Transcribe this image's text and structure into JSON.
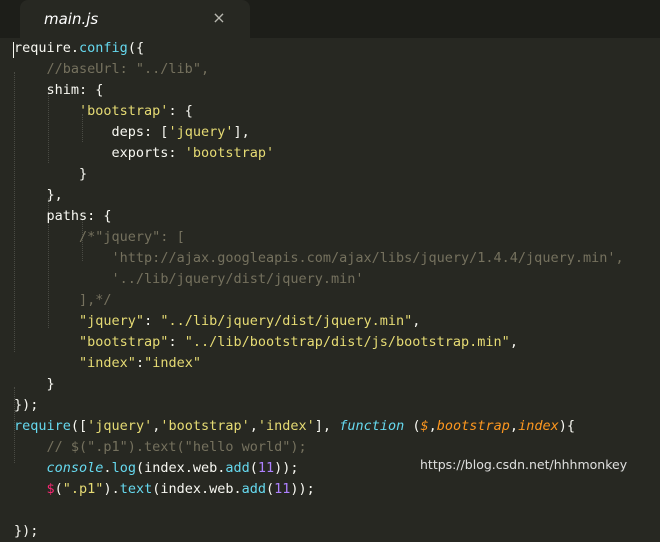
{
  "tab": {
    "title": "main.js",
    "close_glyph": "×"
  },
  "watermark": "https://blog.csdn.net/hhhmonkey",
  "colors": {
    "background": "#272822",
    "text": "#f8f8f2",
    "comment": "#75715e",
    "string": "#e6db74",
    "function": "#66d9ef",
    "number": "#ae81ff",
    "parameter": "#fd971f",
    "dollar": "#f92672"
  },
  "code_lines": [
    [
      [
        "plain",
        "require"
      ],
      [
        "plain",
        "."
      ],
      [
        "func",
        "config"
      ],
      [
        "plain",
        "({"
      ]
    ],
    [
      [
        "plain",
        "    "
      ],
      [
        "comment",
        "//baseUrl: \"../lib\","
      ]
    ],
    [
      [
        "plain",
        "    shim: {"
      ]
    ],
    [
      [
        "plain",
        "        "
      ],
      [
        "string",
        "'bootstrap'"
      ],
      [
        "plain",
        ": {"
      ]
    ],
    [
      [
        "plain",
        "            deps: ["
      ],
      [
        "string",
        "'jquery'"
      ],
      [
        "plain",
        "],"
      ]
    ],
    [
      [
        "plain",
        "            exports: "
      ],
      [
        "string",
        "'bootstrap'"
      ]
    ],
    [
      [
        "plain",
        "        }"
      ]
    ],
    [
      [
        "plain",
        "    },"
      ]
    ],
    [
      [
        "plain",
        "    paths: {"
      ]
    ],
    [
      [
        "plain",
        "        "
      ],
      [
        "comment",
        "/*\"jquery\": ["
      ]
    ],
    [
      [
        "plain",
        "            "
      ],
      [
        "comment",
        "'http://ajax.googleapis.com/ajax/libs/jquery/1.4.4/jquery.min',"
      ]
    ],
    [
      [
        "plain",
        "            "
      ],
      [
        "comment",
        "'../lib/jquery/dist/jquery.min'"
      ]
    ],
    [
      [
        "plain",
        "        "
      ],
      [
        "comment",
        "],*/"
      ]
    ],
    [
      [
        "plain",
        "        "
      ],
      [
        "string",
        "\"jquery\""
      ],
      [
        "plain",
        ": "
      ],
      [
        "string",
        "\"../lib/jquery/dist/jquery.min\""
      ],
      [
        "plain",
        ","
      ]
    ],
    [
      [
        "plain",
        "        "
      ],
      [
        "string",
        "\"bootstrap\""
      ],
      [
        "plain",
        ": "
      ],
      [
        "string",
        "\"../lib/bootstrap/dist/js/bootstrap.min\""
      ],
      [
        "plain",
        ","
      ]
    ],
    [
      [
        "plain",
        "        "
      ],
      [
        "string",
        "\"index\""
      ],
      [
        "plain",
        ":"
      ],
      [
        "string",
        "\"index\""
      ]
    ],
    [
      [
        "plain",
        "    }"
      ]
    ],
    [
      [
        "plain",
        "});"
      ]
    ],
    [
      [
        "func",
        "require"
      ],
      [
        "plain",
        "(["
      ],
      [
        "string",
        "'jquery'"
      ],
      [
        "plain",
        ","
      ],
      [
        "string",
        "'bootstrap'"
      ],
      [
        "plain",
        ","
      ],
      [
        "string",
        "'index'"
      ],
      [
        "plain",
        "], "
      ],
      [
        "keyword",
        "function"
      ],
      [
        "plain",
        " ("
      ],
      [
        "param",
        "$"
      ],
      [
        "plain",
        ","
      ],
      [
        "param",
        "bootstrap"
      ],
      [
        "plain",
        ","
      ],
      [
        "param",
        "index"
      ],
      [
        "plain",
        "){"
      ]
    ],
    [
      [
        "plain",
        "    "
      ],
      [
        "comment",
        "// $(\".p1\").text(\"hello world\");"
      ]
    ],
    [
      [
        "plain",
        "    "
      ],
      [
        "builtin",
        "console"
      ],
      [
        "plain",
        "."
      ],
      [
        "func",
        "log"
      ],
      [
        "plain",
        "(index.web."
      ],
      [
        "func",
        "add"
      ],
      [
        "plain",
        "("
      ],
      [
        "number",
        "11"
      ],
      [
        "plain",
        "));"
      ]
    ],
    [
      [
        "plain",
        "    "
      ],
      [
        "dollar",
        "$"
      ],
      [
        "plain",
        "("
      ],
      [
        "string",
        "\".p1\""
      ],
      [
        "plain",
        ")."
      ],
      [
        "func",
        "text"
      ],
      [
        "plain",
        "(index.web."
      ],
      [
        "func",
        "add"
      ],
      [
        "plain",
        "("
      ],
      [
        "number",
        "11"
      ],
      [
        "plain",
        "));"
      ]
    ],
    [
      [
        "plain",
        ""
      ]
    ],
    [
      [
        "plain",
        "});"
      ]
    ]
  ]
}
